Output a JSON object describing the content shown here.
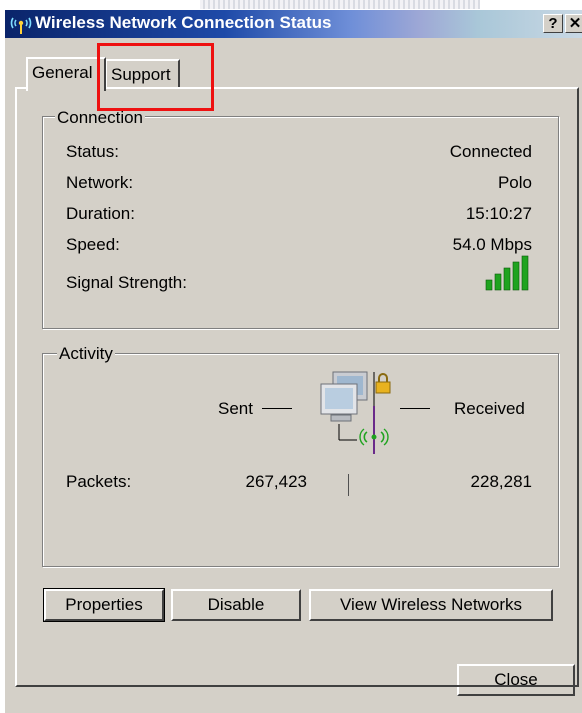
{
  "window": {
    "title": "Wireless Network Connection Status",
    "help_glyph": "?",
    "close_glyph": "✕"
  },
  "tabs": [
    {
      "label": "General",
      "active": true
    },
    {
      "label": "Support",
      "active": false
    }
  ],
  "connection": {
    "group_label": "Connection",
    "rows": [
      {
        "label": "Status:",
        "value": "Connected"
      },
      {
        "label": "Network:",
        "value": "Polo"
      },
      {
        "label": "Duration:",
        "value": "15:10:27"
      },
      {
        "label": "Speed:",
        "value": "54.0 Mbps"
      }
    ],
    "signal_label": "Signal Strength:",
    "signal_bars": 5,
    "signal_bars_filled": 5
  },
  "activity": {
    "group_label": "Activity",
    "sent_label": "Sent",
    "received_label": "Received",
    "packets_label": "Packets:",
    "packets_sent": "267,423",
    "packets_received": "228,281"
  },
  "buttons": {
    "properties": "Properties",
    "disable": "Disable",
    "view_networks": "View Wireless Networks",
    "close": "Close"
  },
  "colors": {
    "highlight": "#ee1111",
    "signal_green": "#1fa31f",
    "dialog_bg": "#d4d0c8"
  }
}
